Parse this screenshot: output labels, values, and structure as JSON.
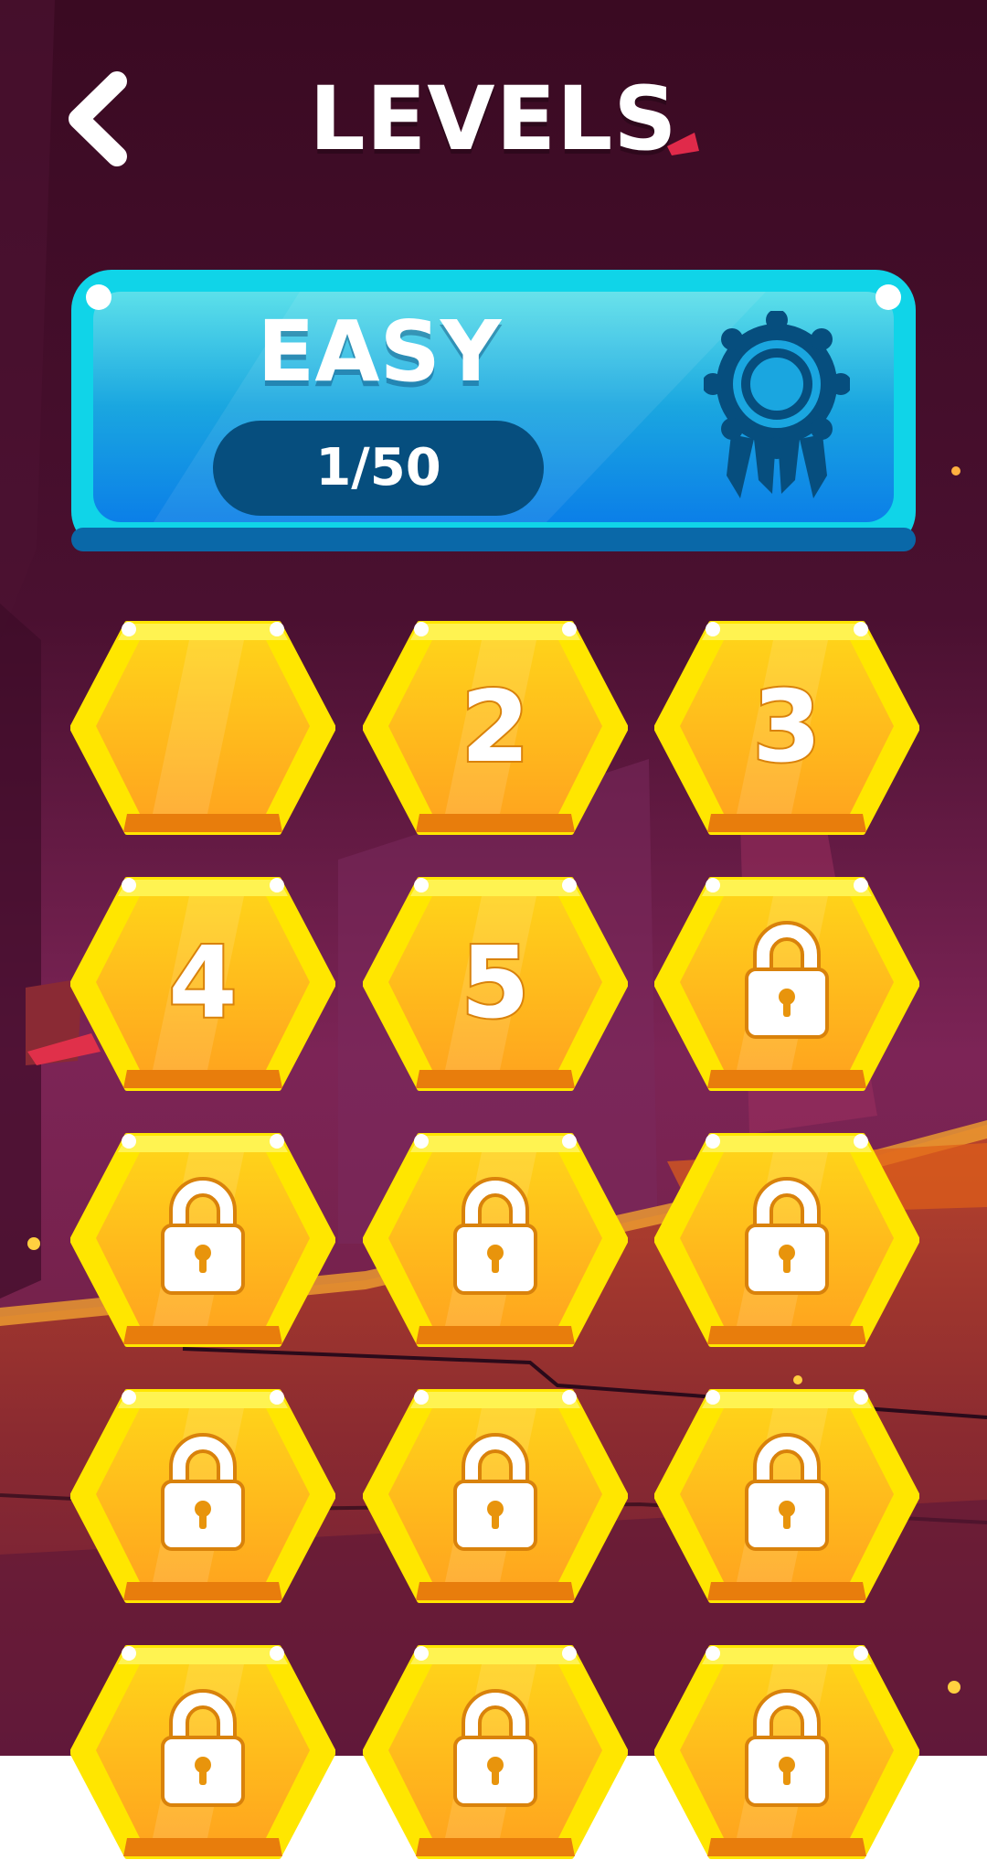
{
  "header": {
    "title": "LEVELS",
    "back_icon": "chevron-left-icon"
  },
  "difficulty": {
    "label": "EASY",
    "progress": "1/50",
    "badge_icon": "award-ribbon-icon",
    "colors": {
      "panel_top": "#5ce0ea",
      "panel_bottom": "#0b7fe8",
      "pill": "#064e7e"
    }
  },
  "levels": [
    {
      "label": "",
      "locked": false
    },
    {
      "label": "2",
      "locked": false
    },
    {
      "label": "3",
      "locked": false
    },
    {
      "label": "4",
      "locked": false
    },
    {
      "label": "5",
      "locked": false
    },
    {
      "label": "",
      "locked": true
    },
    {
      "label": "",
      "locked": true
    },
    {
      "label": "",
      "locked": true
    },
    {
      "label": "",
      "locked": true
    },
    {
      "label": "",
      "locked": true
    },
    {
      "label": "",
      "locked": true
    },
    {
      "label": "",
      "locked": true
    },
    {
      "label": "",
      "locked": true
    },
    {
      "label": "",
      "locked": true
    },
    {
      "label": "",
      "locked": true
    }
  ],
  "colors": {
    "background_top": "#3a0a22",
    "background_mid": "#7c2456",
    "ground": "#a63a2a",
    "hex_outer": "#ffe600",
    "hex_inner": "#ffb41e"
  }
}
